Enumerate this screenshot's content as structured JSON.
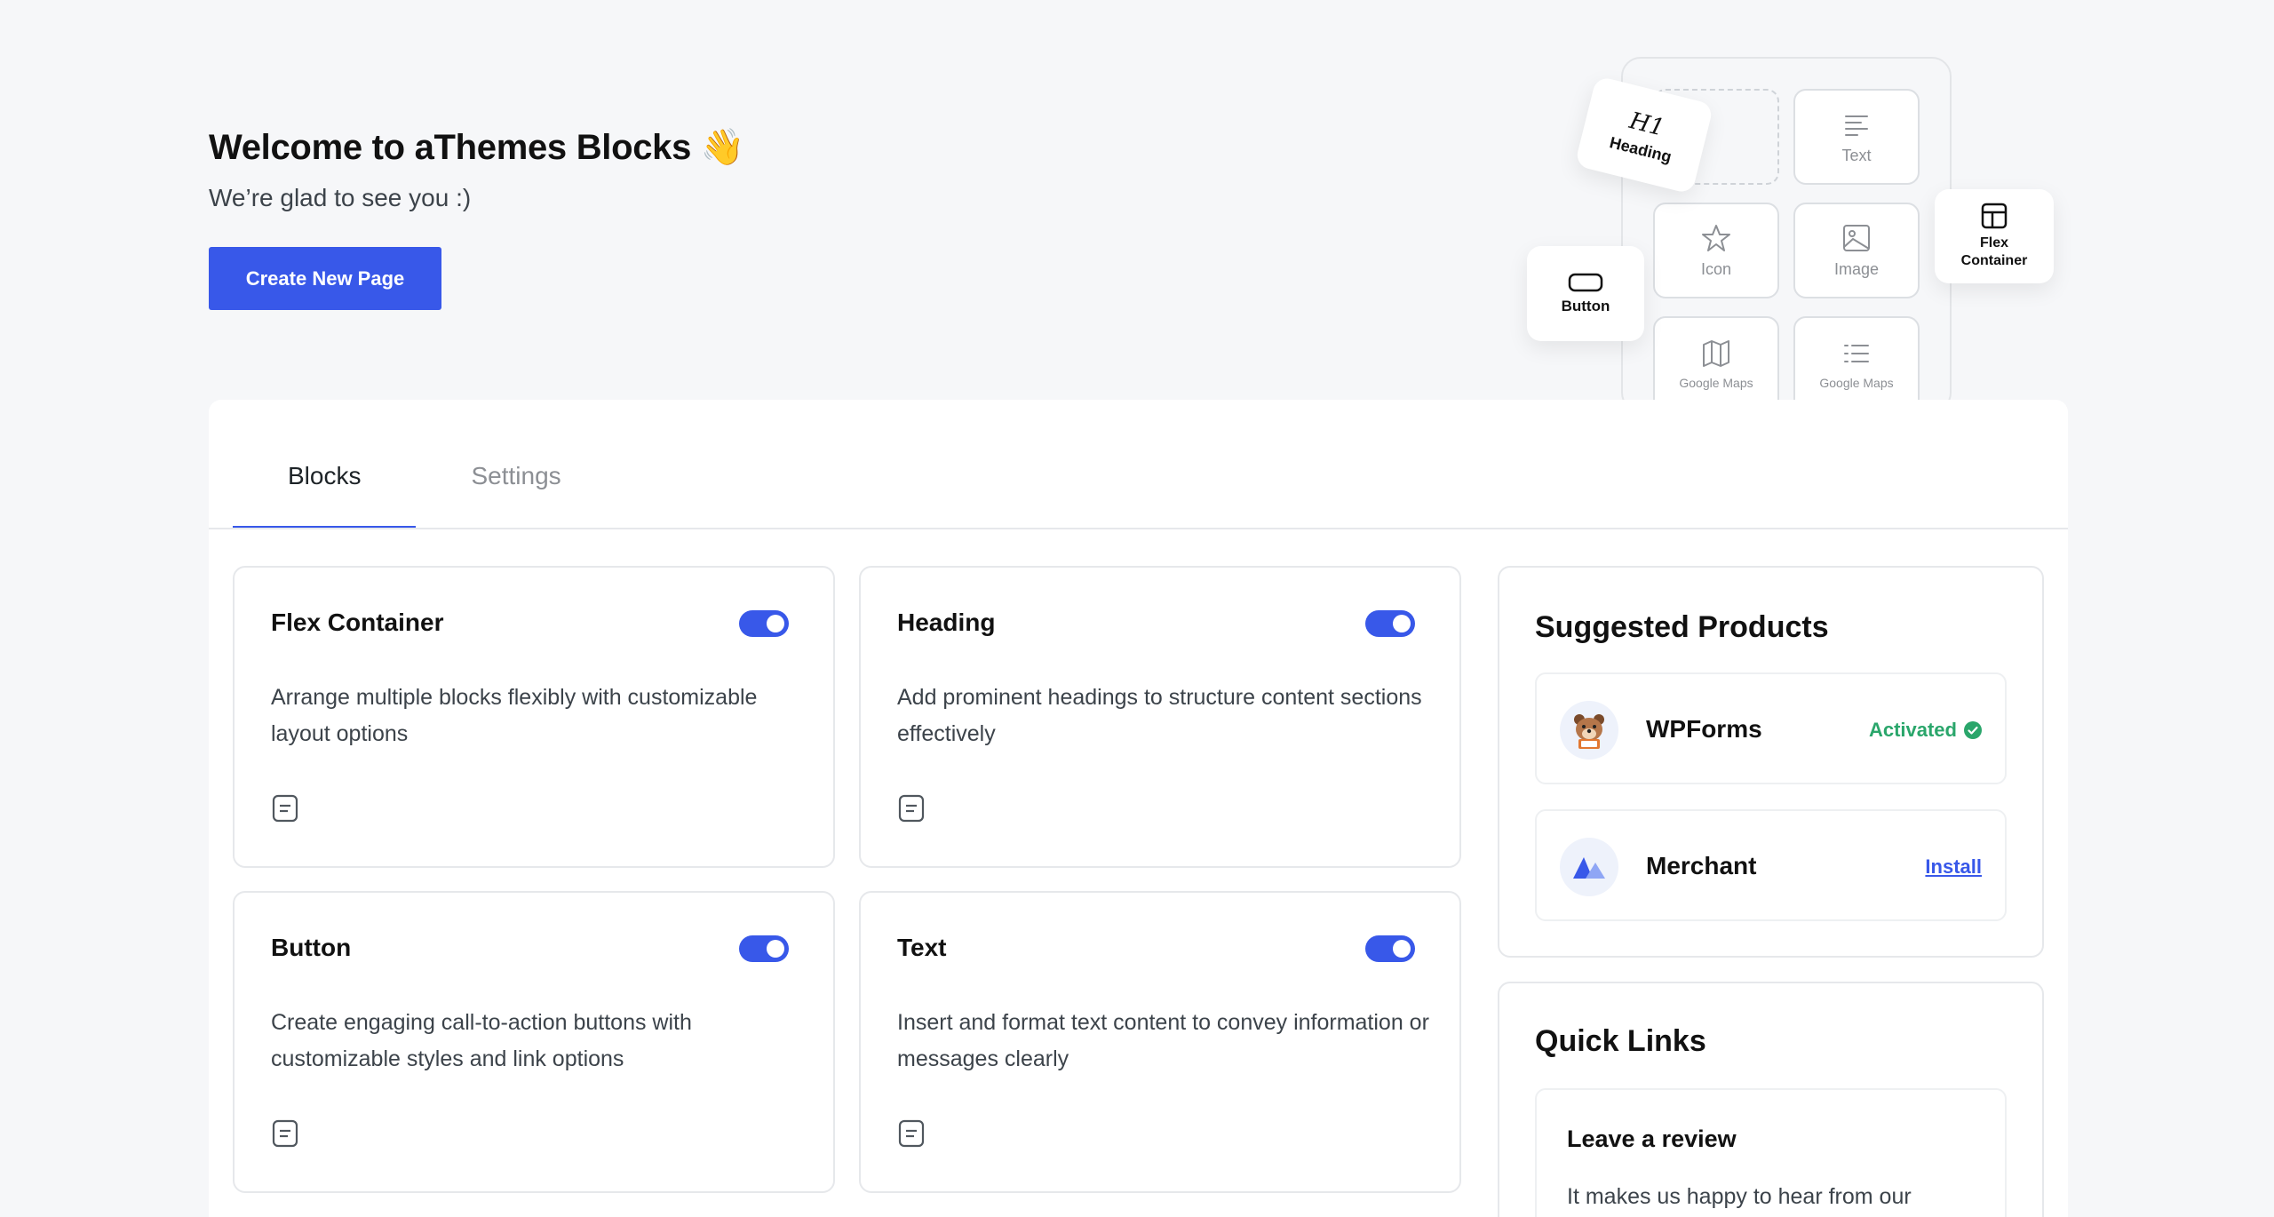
{
  "hero": {
    "title": "Welcome to aThemes Blocks 👋",
    "subtitle": "We’re glad to see you :)",
    "cta_label": "Create New Page"
  },
  "illustration": {
    "heading_label": "Heading",
    "heading_glyph": "H1",
    "text_label": "Text",
    "icon_label": "Icon",
    "image_label": "Image",
    "maps_label_1": "Google Maps",
    "maps_label_2": "Google Maps",
    "button_label": "Button",
    "flex_label_line1": "Flex",
    "flex_label_line2": "Container"
  },
  "tabs": [
    {
      "label": "Blocks",
      "active": true
    },
    {
      "label": "Settings",
      "active": false
    }
  ],
  "blocks": [
    {
      "title": "Flex Container",
      "description": "Arrange multiple blocks flexibly with customizable layout options",
      "enabled": true
    },
    {
      "title": "Heading",
      "description": "Add prominent headings to structure content sections effectively",
      "enabled": true
    },
    {
      "title": "Button",
      "description": "Create engaging call-to-action buttons with customizable styles and link options",
      "enabled": true
    },
    {
      "title": "Text",
      "description": "Insert and format text content to convey information or messages clearly",
      "enabled": true
    }
  ],
  "suggested": {
    "title": "Suggested Products",
    "products": [
      {
        "name": "WPForms",
        "status": "Activated"
      },
      {
        "name": "Merchant",
        "action": "Install"
      }
    ]
  },
  "quick_links": {
    "title": "Quick Links",
    "items": [
      {
        "title": "Leave a review",
        "description": "It makes us happy to hear from our"
      }
    ]
  },
  "colors": {
    "accent": "#3858e9",
    "success": "#2aa66b",
    "background": "#f6f7f9"
  }
}
